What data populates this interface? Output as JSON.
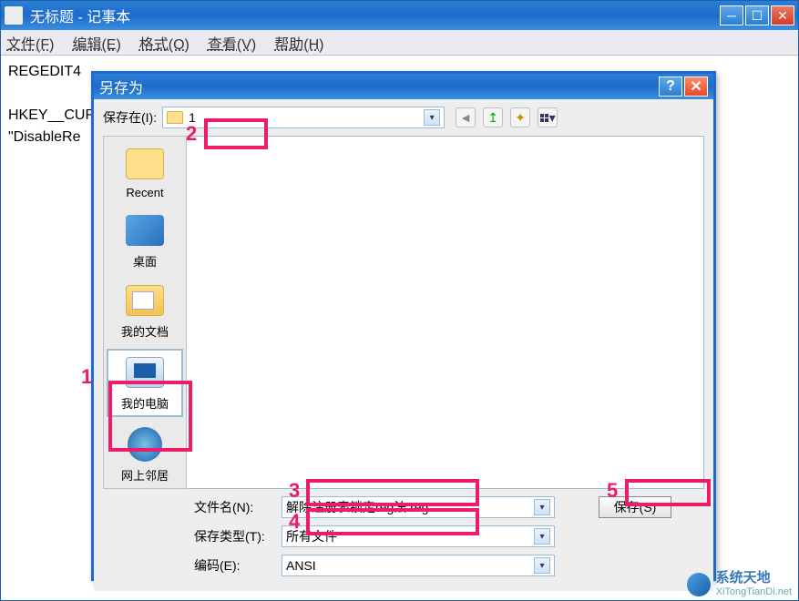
{
  "notepad": {
    "title": "无标题 - 记事本",
    "menu": {
      "file": "文件(F)",
      "edit": "编辑(E)",
      "format": "格式(O)",
      "view": "查看(V)",
      "help": "帮助(H)"
    },
    "content_line1": "REGEDIT4",
    "content_line2": "HKEY__CURR",
    "content_line3": "\"DisableRe"
  },
  "saveas": {
    "title": "另存为",
    "savein_label": "保存在(I):",
    "savein_value": "1",
    "places": {
      "recent": "Recent",
      "desktop": "桌面",
      "documents": "我的文档",
      "computer": "我的电脑",
      "network": "网上邻居"
    },
    "filename_label": "文件名(N):",
    "filename_value": "解除注册表锁定reg法.reg",
    "filetype_label": "保存类型(T):",
    "filetype_value": "所有文件",
    "encoding_label": "编码(E):",
    "encoding_value": "ANSI",
    "save_button": "保存(S)"
  },
  "annotations": {
    "n1": "1",
    "n2": "2",
    "n3": "3",
    "n4": "4",
    "n5": "5"
  },
  "watermark": {
    "zh": "系统天地",
    "en": "XiTongTianDi.net"
  }
}
